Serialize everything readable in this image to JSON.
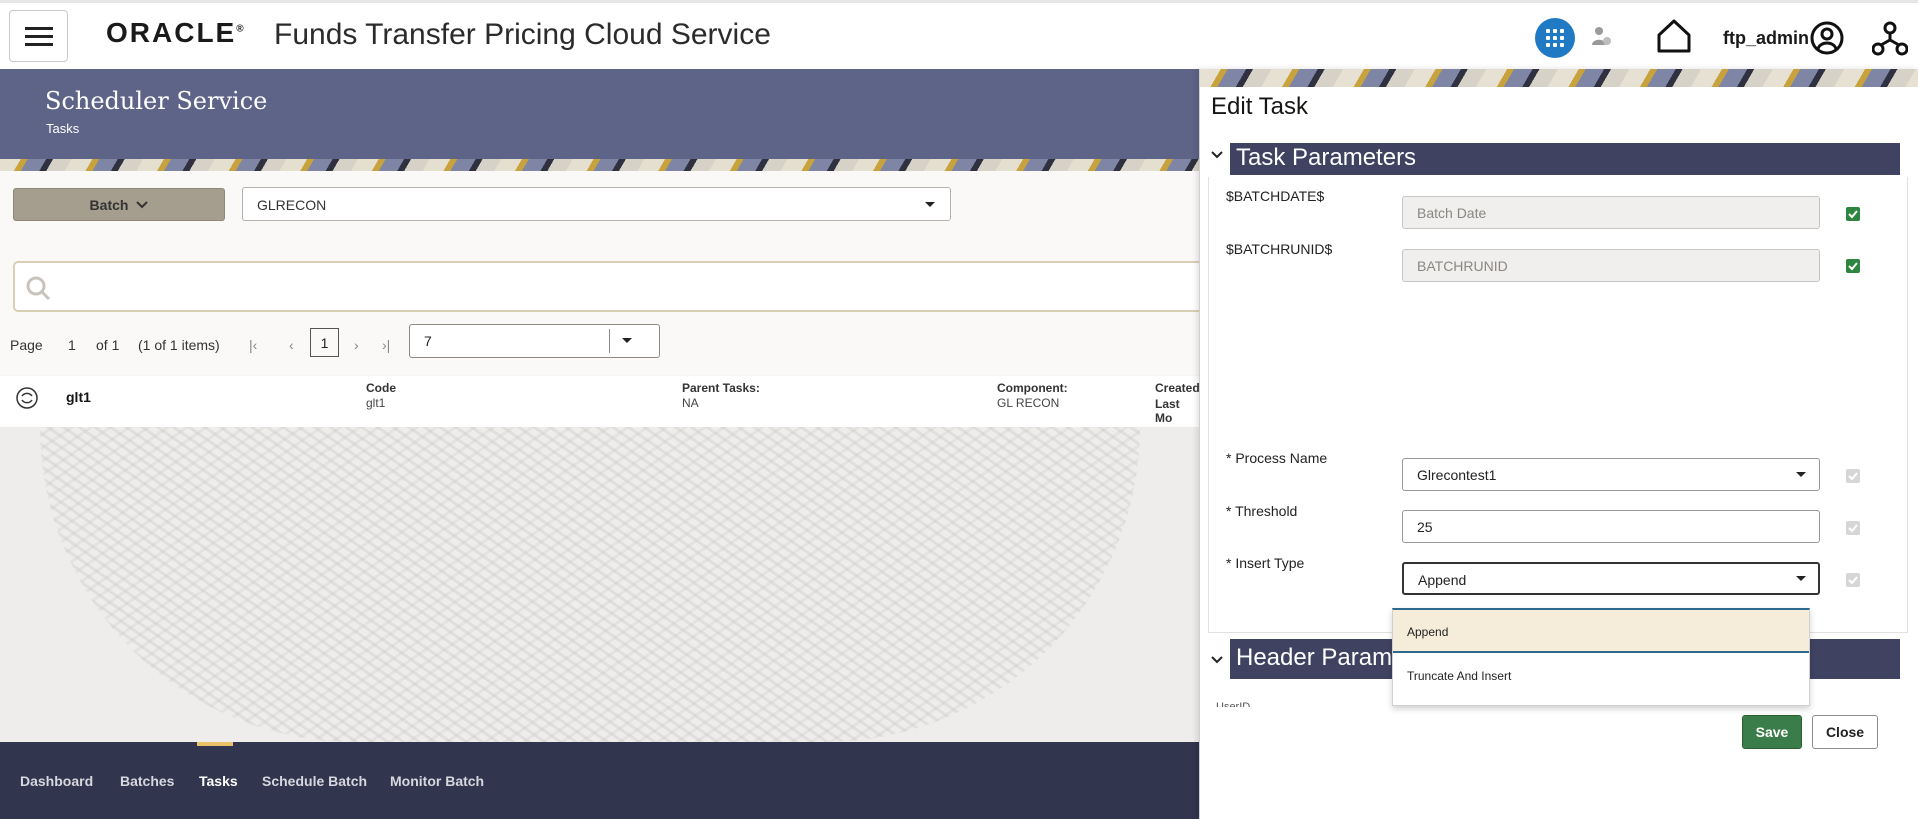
{
  "header": {
    "brand": "ORACLE",
    "product": "Funds Transfer Pricing Cloud Service",
    "username": "ftp_admin",
    "accent": "#2079c3"
  },
  "banner": {
    "title": "Scheduler Service",
    "subtitle": "Tasks"
  },
  "toolbar": {
    "batch_label": "Batch",
    "batch_selected": "GLRECON"
  },
  "pager": {
    "page_label": "Page",
    "page_number": "1",
    "of_label": "of 1",
    "items_label": "(1 of 1 items)",
    "current_page": "1",
    "page_size": "7"
  },
  "task_row": {
    "name": "glt1",
    "code_label": "Code",
    "code_value": "glt1",
    "parent_label": "Parent Tasks:",
    "parent_value": "NA",
    "component_label": "Component:",
    "component_value": "GL RECON",
    "created_label": "Created",
    "modified_label": "Last Mo"
  },
  "bottom_nav": {
    "items": [
      {
        "label": "Dashboard"
      },
      {
        "label": "Batches"
      },
      {
        "label": "Tasks"
      },
      {
        "label": "Schedule Batch"
      },
      {
        "label": "Monitor Batch"
      }
    ],
    "active": "Tasks"
  },
  "drawer": {
    "title": "Edit Task",
    "section_task": "Task Parameters",
    "section_header": "Header Parameters",
    "params": [
      {
        "label": "$BATCHDATE$",
        "value": "Batch Date",
        "checked": true
      },
      {
        "label": "$BATCHRUNID$",
        "value": "BATCHRUNID",
        "checked": true
      },
      {
        "label": "* Process Name",
        "value": "Glrecontest1",
        "checked": false
      },
      {
        "label": "* Threshold",
        "value": "25",
        "checked": false
      },
      {
        "label": "* Insert Type",
        "value": "Append",
        "checked": false
      }
    ],
    "insert_type_options": [
      "Append",
      "Truncate And Insert"
    ],
    "header_peek": "UserID",
    "save_label": "Save",
    "close_label": "Close",
    "save_color": "#3b7d4a"
  }
}
